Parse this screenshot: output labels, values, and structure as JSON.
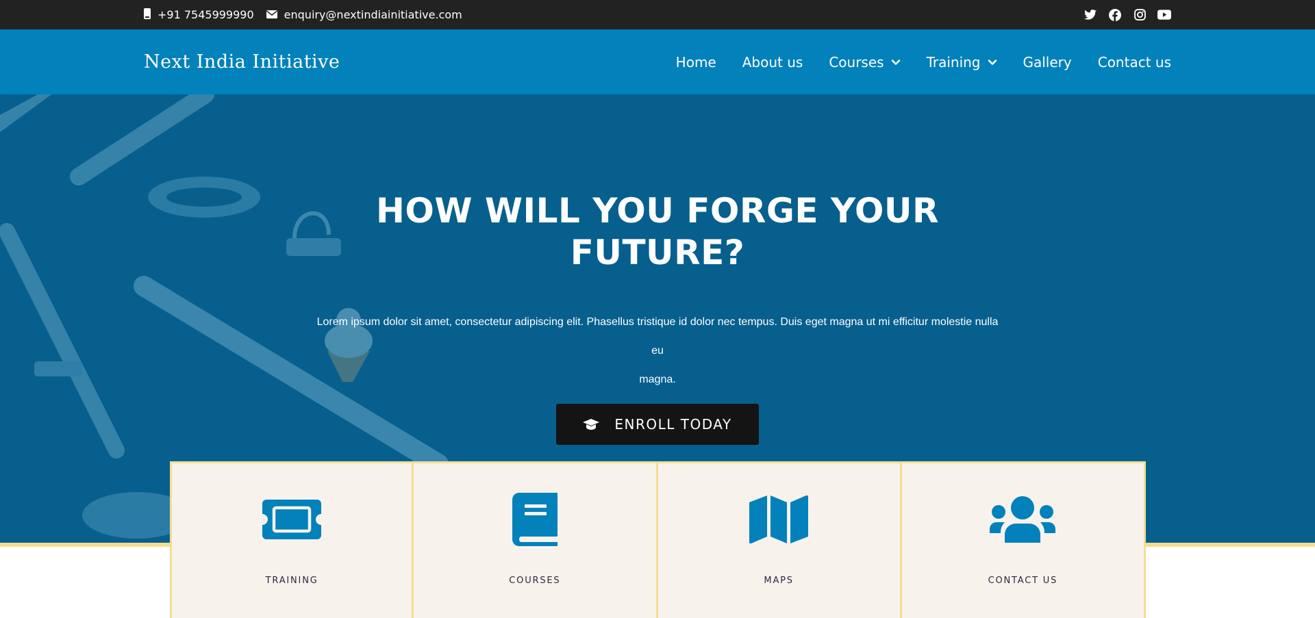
{
  "topbar": {
    "phone": "+91 7545999990",
    "email": "enquiry@nextindiainitiative.com",
    "social": [
      "twitter-icon",
      "facebook-icon",
      "instagram-icon",
      "youtube-icon"
    ]
  },
  "header": {
    "logo": "Next India Initiative",
    "nav": [
      {
        "label": "Home"
      },
      {
        "label": "About us"
      },
      {
        "label": "Courses",
        "dropdown": true
      },
      {
        "label": "Training",
        "dropdown": true
      },
      {
        "label": "Gallery"
      },
      {
        "label": "Contact us"
      }
    ]
  },
  "hero": {
    "title_line1": "HOW WILL YOU FORGE YOUR",
    "title_line2": "FUTURE?",
    "text_line1": "Lorem ipsum dolor sit amet, consectetur adipiscing elit. Phasellus tristique id dolor nec tempus. Duis eget magna ut mi efficitur molestie nulla eu",
    "text_line2": "magna.",
    "button_label": "ENROLL TODAY",
    "button_icon": "graduation-cap-icon"
  },
  "cards": [
    {
      "label": "TRAINING",
      "icon": "ticket-icon"
    },
    {
      "label": "COURSES",
      "icon": "book-icon"
    },
    {
      "label": "MAPS",
      "icon": "map-icon"
    },
    {
      "label": "CONTACT US",
      "icon": "users-icon"
    }
  ],
  "colors": {
    "topbar": "#222222",
    "header": "#0381bb",
    "hero": "#075f8d",
    "accent_icon": "#0381bb",
    "card_bg": "#f7f3ec",
    "card_border": "#f3dd95",
    "button": "#141414"
  }
}
